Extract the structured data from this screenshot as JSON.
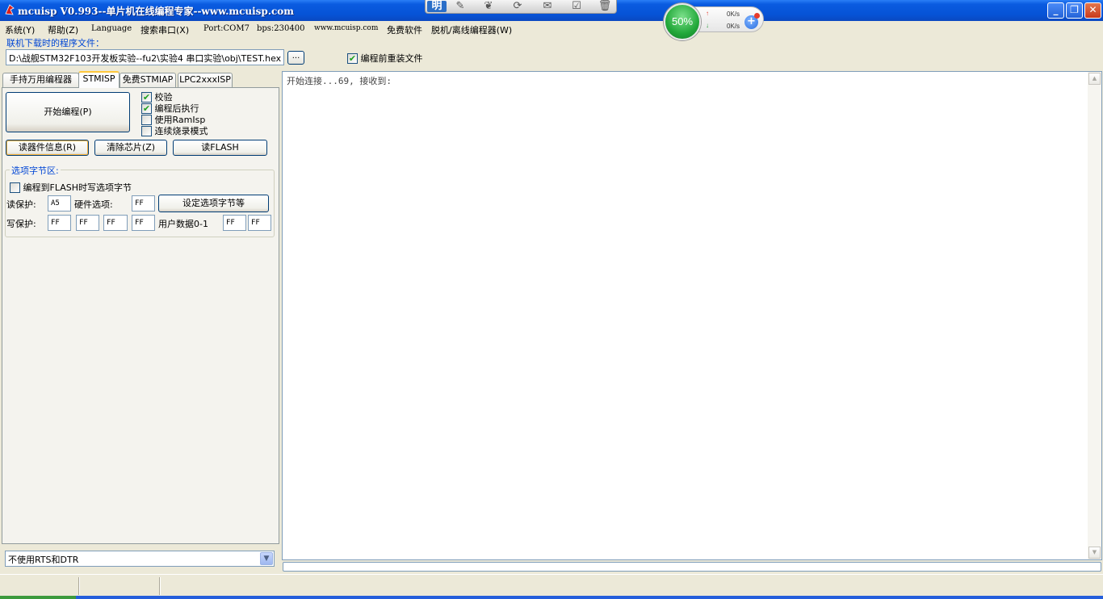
{
  "window": {
    "title": "mcuisp V0.993--单片机在线编程专家--www.mcuisp.com",
    "minimize": "_",
    "restore": "❐",
    "close": "✕"
  },
  "float_toolbar": {
    "ming": "明",
    "icons": [
      "edit-icon",
      "leaf-icon",
      "refresh-icon",
      "mail-icon",
      "check-icon",
      "trash-icon"
    ]
  },
  "speed_widget": {
    "percent": "50%",
    "upload": "0K/s",
    "download": "0K/s",
    "up_arrow": "↑",
    "down_arrow": "↓",
    "plus": "+"
  },
  "menu": {
    "items": [
      "系统(Y)",
      "帮助(Z)",
      "Language",
      "搜索串口(X)",
      "Port:COM7",
      "bps:230400",
      "www.mcuisp.com",
      "免费软件",
      "脱机/离线编程器(W)"
    ]
  },
  "file": {
    "label": "联机下载时的程序文件：",
    "path": "D:\\战舰STM32F103开发板实验--fu2\\实验4 串口实验\\obj\\TEST.hex",
    "browse": "...",
    "reload_label": "编程前重装文件",
    "reload_checked": true
  },
  "tabs": [
    "手持万用编程器",
    "STMISP",
    "免费STMIAP",
    "LPC2xxxISP"
  ],
  "stmisp": {
    "start_button": "开始编程(P)",
    "checkboxes": [
      {
        "label": "校验",
        "checked": true
      },
      {
        "label": "编程后执行",
        "checked": true
      },
      {
        "label": "使用RamIsp",
        "checked": false
      },
      {
        "label": "连续烧录模式",
        "checked": false
      }
    ],
    "read_info_button": "读器件信息(R)",
    "erase_button": "清除芯片(Z)",
    "read_flash_button": "读FLASH",
    "options": {
      "title": "选项字节区:",
      "write_options_label": "编程到FLASH时写选项字节",
      "write_options_checked": false,
      "read_protect_label": "读保护:",
      "read_protect_value": "A5",
      "hw_option_label": "硬件选项:",
      "hw_option_value": "FF",
      "set_button": "设定选项字节等",
      "write_protect_label": "写保护:",
      "write_protect_values": [
        "FF",
        "FF",
        "FF",
        "FF"
      ],
      "user_data_label": "用户数据0-1",
      "user_data_values": [
        "FF",
        "FF"
      ]
    }
  },
  "bottom_select": {
    "value": "不使用RTS和DTR"
  },
  "log": {
    "text": "开始连接...69, 接收到:"
  }
}
